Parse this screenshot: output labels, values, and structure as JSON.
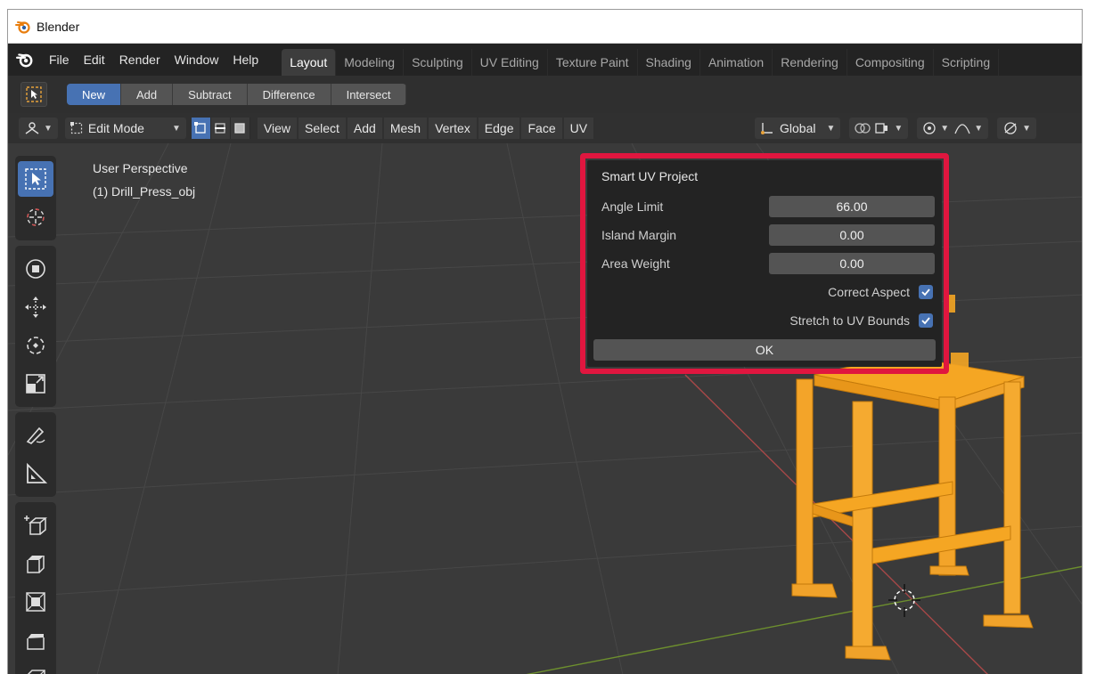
{
  "window": {
    "title": "Blender"
  },
  "menubar": {
    "items": [
      "File",
      "Edit",
      "Render",
      "Window",
      "Help"
    ],
    "workspace_tabs": [
      "Layout",
      "Modeling",
      "Sculpting",
      "UV Editing",
      "Texture Paint",
      "Shading",
      "Animation",
      "Rendering",
      "Compositing",
      "Scripting"
    ],
    "active_tab": "Layout"
  },
  "tool_settings": {
    "boolean_modes": [
      "New",
      "Add",
      "Subtract",
      "Difference",
      "Intersect"
    ],
    "active_mode": "New"
  },
  "header": {
    "mode": "Edit Mode",
    "menus": [
      "View",
      "Select",
      "Add",
      "Mesh",
      "Vertex",
      "Edge",
      "Face",
      "UV"
    ],
    "orientation": "Global"
  },
  "viewport": {
    "view_name": "User Perspective",
    "object_name": "(1) Drill_Press_obj"
  },
  "dialog": {
    "title": "Smart UV Project",
    "fields": [
      {
        "label": "Angle Limit",
        "value": "66.00"
      },
      {
        "label": "Island Margin",
        "value": "0.00"
      },
      {
        "label": "Area Weight",
        "value": "0.00"
      }
    ],
    "checkboxes": [
      {
        "label": "Correct Aspect",
        "checked": true
      },
      {
        "label": "Stretch to UV Bounds",
        "checked": true
      }
    ],
    "ok_label": "OK"
  },
  "colors": {
    "accent": "#4772b3",
    "highlight": "#e0163f",
    "mesh": "#f5a623"
  }
}
